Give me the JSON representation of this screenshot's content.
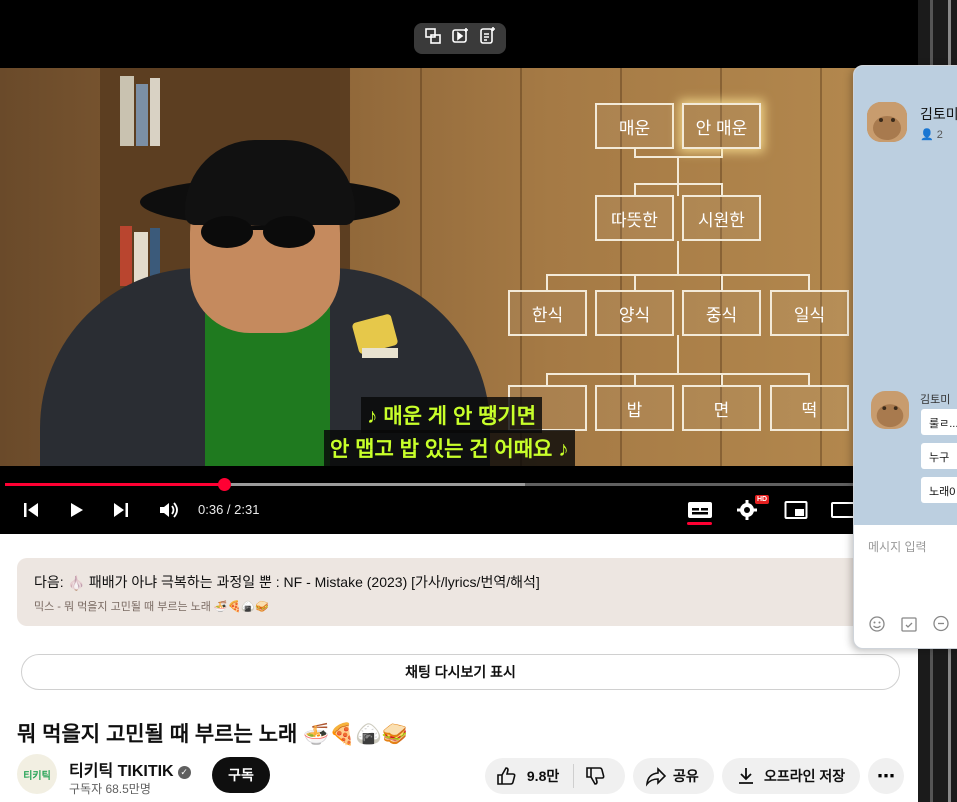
{
  "player": {
    "time": "0:36 / 2:31",
    "hd_badge": "HD",
    "progress_played": 0.24,
    "progress_buffered": 0.57
  },
  "diagram": {
    "row1": [
      "매운",
      "안 매운"
    ],
    "row2": [
      "따뜻한",
      "시원한"
    ],
    "row3": [
      "한식",
      "양식",
      "중식",
      "일식"
    ],
    "row4": [
      "밥",
      "면",
      "떡"
    ]
  },
  "captions": {
    "line1": "♪ 매운 게 안 땡기면",
    "line2": "안 맵고 밥 있는 건 어때요 ♪"
  },
  "next_up": {
    "label": "다음:",
    "emoji": "🧄",
    "title": "패배가 아냐 극복하는 과정일 뿐 : NF - Mistake (2023) [가사/lyrics/번역/해석]",
    "mix": "믹스 - 뭐 먹을지 고민될 때 부르는 노래 🍜🍕🍙🥪"
  },
  "chat_replay_button": "채팅 다시보기 표시",
  "video": {
    "title": "뭐 먹을지 고민될 때 부르는 노래 🍜🍕🍙🥪"
  },
  "channel": {
    "avatar_text": "티키틱",
    "name": "티키틱 TIKITIK",
    "verified": "✓",
    "subscribers": "구독자 68.5만명",
    "subscribe_label": "구독"
  },
  "actions": {
    "likes": "9.8만",
    "share": "공유",
    "download": "오프라인 저장",
    "more": "⋯"
  },
  "chat_window": {
    "title": "김토미",
    "member_count": "2",
    "sender": "김토미",
    "messages": [
      "룰ㄹ...",
      "누구",
      "노래0"
    ],
    "input_placeholder": "메시지 입력"
  },
  "colors": {
    "accent_red": "#ff0033",
    "caption_text": "#c8ff2a",
    "chat_bg": "#bccfe0"
  }
}
